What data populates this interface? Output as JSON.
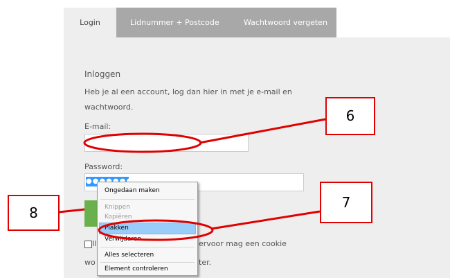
{
  "tabs": [
    {
      "label": "Login",
      "active": true
    },
    {
      "label": "Lidnummer + Postcode",
      "active": false
    },
    {
      "label": "Wachtwoord vergeten",
      "active": false
    }
  ],
  "login": {
    "heading": "Inloggen",
    "intro": "Heb je al een account, log dan hier in met je e-mail en wachtwoord.",
    "email_label": "E-mail:",
    "email_value": "",
    "password_label": "Password:",
    "password_masked": "●●●●●●●●",
    "remember_fragment_left": "Il",
    "remember_fragment_right": "ervoor mag een cookie",
    "second_line_left": "wo",
    "second_line_right": "ter."
  },
  "context_menu": {
    "items": [
      {
        "label": "Ongedaan maken",
        "enabled": true
      },
      {
        "label": "Knippen",
        "enabled": false
      },
      {
        "label": "Kopiëren",
        "enabled": false
      },
      {
        "label": "Plakken",
        "enabled": true,
        "highlighted": true
      },
      {
        "label": "Verwijderen",
        "enabled": true
      },
      {
        "label": "Alles selecteren",
        "enabled": true
      },
      {
        "label": "Element controleren",
        "enabled": true
      }
    ]
  },
  "annotations": {
    "six": "6",
    "seven": "7",
    "eight": "8",
    "color": "#e00000"
  }
}
